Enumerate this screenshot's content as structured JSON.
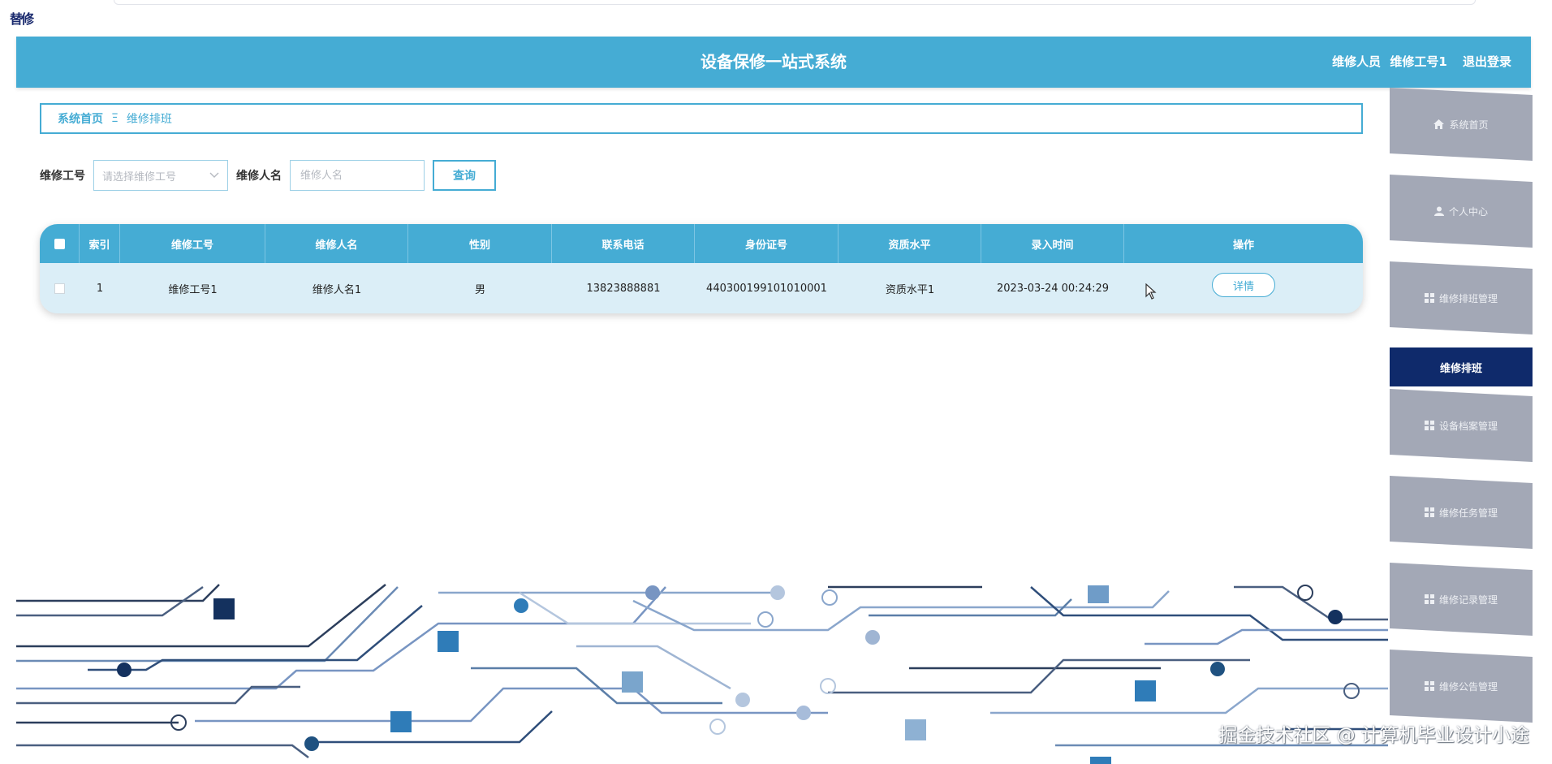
{
  "corner_mark": "替修",
  "header": {
    "title": "设备保修一站式系统",
    "role": "维修人员",
    "username": "维修工号1",
    "logout": "退出登录"
  },
  "breadcrumb": {
    "home": "系统首页",
    "separator": "Ξ",
    "current": "维修排班"
  },
  "search": {
    "field1_label": "维修工号",
    "field1_placeholder": "请选择维修工号",
    "field2_label": "维修人名",
    "field2_placeholder": "维修人名",
    "query_label": "查询"
  },
  "table": {
    "headers": [
      "索引",
      "维修工号",
      "维修人名",
      "性别",
      "联系电话",
      "身份证号",
      "资质水平",
      "录入时间",
      "操作"
    ],
    "rows": [
      {
        "index": "1",
        "worker_id": "维修工号1",
        "worker_name": "维修人名1",
        "gender": "男",
        "phone": "13823888881",
        "id_card": "440300199101010001",
        "qualification": "资质水平1",
        "created_at": "2023-03-24 00:24:29",
        "action": "详情"
      }
    ]
  },
  "sidebar": {
    "items": [
      {
        "label": "系统首页",
        "icon": "home-icon"
      },
      {
        "label": "个人中心",
        "icon": "user-icon"
      },
      {
        "label": "维修排班管理",
        "icon": "grid-icon"
      },
      {
        "label": "维修排班",
        "icon": "",
        "active": true
      },
      {
        "label": "设备档案管理",
        "icon": "grid-icon"
      },
      {
        "label": "维修任务管理",
        "icon": "grid-icon"
      },
      {
        "label": "维修记录管理",
        "icon": "grid-icon"
      },
      {
        "label": "维修公告管理",
        "icon": "grid-icon"
      }
    ]
  },
  "watermark": "掘金技术社区 @ 计算机毕业设计小途",
  "colors": {
    "primary": "#45acd4",
    "sidebar_active": "#0f2a6b",
    "sidebar_item": "#a3a8b6",
    "row_bg": "#dbeef7"
  }
}
